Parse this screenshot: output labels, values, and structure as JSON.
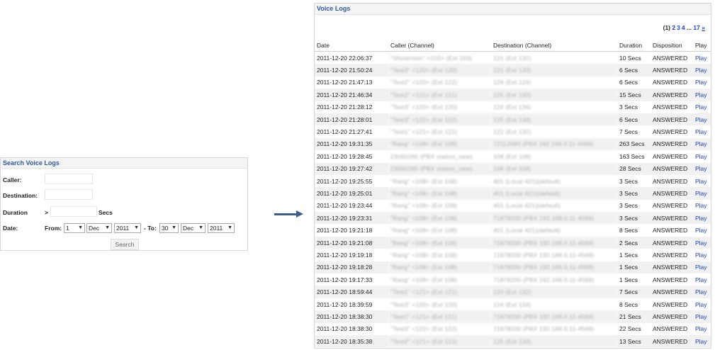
{
  "search": {
    "title": "Search Voice Logs",
    "caller_label": "Caller:",
    "destination_label": "Destination:",
    "duration_label": "Duration",
    "duration_op": ">",
    "duration_unit": "Secs",
    "date_label": "Date:",
    "from_label": "From:",
    "from_day": "1",
    "from_month": "Dec",
    "from_year": "2011",
    "to_label": "- To:",
    "to_day": "30",
    "to_month": "Dec",
    "to_year": "2011",
    "button": "Search"
  },
  "logs": {
    "title": "Voice Logs",
    "pagination": {
      "current": "(1)",
      "pages": [
        "2",
        "3",
        "4"
      ],
      "ellipsis": "...",
      "last": "17",
      "next": "»"
    },
    "columns": {
      "date": "Date",
      "caller": "Caller (Channel)",
      "destination": "Destination (Channel)",
      "duration": "Duration",
      "disposition": "Disposition",
      "play": "Play"
    },
    "rows": [
      {
        "date": "2011-12-20 22:06:37",
        "caller": "\"Showroom\" <103> (Ext 103)",
        "destination": "121 (Ext 132)",
        "duration": "10 Secs",
        "disposition": "ANSWERED",
        "play": "Play"
      },
      {
        "date": "2011-12-20 21:50:24",
        "caller": "\"Test3\" <120> (Ext 120)",
        "destination": "121 (Ext 133)",
        "duration": "6 Secs",
        "disposition": "ANSWERED",
        "play": "Play"
      },
      {
        "date": "2011-12-20 21:47:13",
        "caller": "\"Test2\" <120> (Ext 122)",
        "destination": "126 (Ext 124)",
        "duration": "6 Secs",
        "disposition": "ANSWERED",
        "play": "Play"
      },
      {
        "date": "2011-12-20 21:46:34",
        "caller": "\"Test2\" <121> (Ext 121)",
        "destination": "125 (Ext 133)",
        "duration": "15 Secs",
        "disposition": "ANSWERED",
        "play": "Play"
      },
      {
        "date": "2011-12-20 21:28:12",
        "caller": "\"Test3\" <120> (Ext 120)",
        "destination": "124 (Ext 134)",
        "duration": "3 Secs",
        "disposition": "ANSWERED",
        "play": "Play"
      },
      {
        "date": "2011-12-20 21:28:01",
        "caller": "\"Test3\" <122> (Ext 122)",
        "destination": "125 (Ext 133)",
        "duration": "6 Secs",
        "disposition": "ANSWERED",
        "play": "Play"
      },
      {
        "date": "2011-12-20 21:27:41",
        "caller": "\"Test1\" <121> (Ext 121)",
        "destination": "122 (Ext 132)",
        "duration": "7 Secs",
        "disposition": "ANSWERED",
        "play": "Play"
      },
      {
        "date": "2011-12-20 19:31:35",
        "caller": "\"Rang\" <108> (Ext 108)",
        "destination": "72112680 (PBX 192.168.0.11-4569)",
        "duration": "263 Secs",
        "disposition": "ANSWERED",
        "play": "Play"
      },
      {
        "date": "2011-12-20 19:28:45",
        "caller": "23060265 (PBX station_new)",
        "destination": "108 (Ext 108)",
        "duration": "163 Secs",
        "disposition": "ANSWERED",
        "play": "Play"
      },
      {
        "date": "2011-12-20 19:27:42",
        "caller": "23060265 (PBX station_new)",
        "destination": "108 (Ext 108)",
        "duration": "28 Secs",
        "disposition": "ANSWERED",
        "play": "Play"
      },
      {
        "date": "2011-12-20 19:25:55",
        "caller": "\"Rang\" <108> (Ext 108)",
        "destination": "401 (Local 421)(default)",
        "duration": "3 Secs",
        "disposition": "ANSWERED",
        "play": "Play"
      },
      {
        "date": "2011-12-20 19:25:01",
        "caller": "\"Rang\" <108> (Ext 108)",
        "destination": "401 (Local 421)(default)",
        "duration": "3 Secs",
        "disposition": "ANSWERED",
        "play": "Play"
      },
      {
        "date": "2011-12-20 19:23:44",
        "caller": "\"Rang\" <108> (Ext 108)",
        "destination": "401 (Local 421)(default)",
        "duration": "3 Secs",
        "disposition": "ANSWERED",
        "play": "Play"
      },
      {
        "date": "2011-12-20 19:23:31",
        "caller": "\"Rang\" <108> (Ext 108)",
        "destination": "71878200 (PBX 192.168.0.11-4569)",
        "duration": "3 Secs",
        "disposition": "ANSWERED",
        "play": "Play"
      },
      {
        "date": "2011-12-20 19:21:18",
        "caller": "\"Rang\" <108> (Ext 108)",
        "destination": "401 (Local 421)(default)",
        "duration": "8 Secs",
        "disposition": "ANSWERED",
        "play": "Play"
      },
      {
        "date": "2011-12-20 19:21:08",
        "caller": "\"Rang\" <108> (Ext 108)",
        "destination": "71878200 (PBX 192.168.0.11-4569)",
        "duration": "2 Secs",
        "disposition": "ANSWERED",
        "play": "Play"
      },
      {
        "date": "2011-12-20 19:19:18",
        "caller": "\"Rang\" <108> (Ext 108)",
        "destination": "71878200 (PBX 192.168.0.11-4569)",
        "duration": "1 Secs",
        "disposition": "ANSWERED",
        "play": "Play"
      },
      {
        "date": "2011-12-20 19:18:28",
        "caller": "\"Rang\" <108> (Ext 108)",
        "destination": "71878200 (PBX 192.168.0.11-4569)",
        "duration": "1 Secs",
        "disposition": "ANSWERED",
        "play": "Play"
      },
      {
        "date": "2011-12-20 19:17:33",
        "caller": "\"Rang\" <108> (Ext 108)",
        "destination": "71878200 (PBX 192.168.0.11-4569)",
        "duration": "1 Secs",
        "disposition": "ANSWERED",
        "play": "Play"
      },
      {
        "date": "2011-12-20 18:59:44",
        "caller": "\"Test1\" <121> (Ext 121)",
        "destination": "120 (Ext 132)",
        "duration": "7 Secs",
        "disposition": "ANSWERED",
        "play": "Play"
      },
      {
        "date": "2011-12-20 18:39:59",
        "caller": "\"Test3\" <120> (Ext 120)",
        "destination": "124 (Ext 134)",
        "duration": "8 Secs",
        "disposition": "ANSWERED",
        "play": "Play"
      },
      {
        "date": "2011-12-20 18:38:30",
        "caller": "\"Test1\" <121> (Ext 121)",
        "destination": "71878200 (PBX 192.168.0.11-4569)",
        "duration": "21 Secs",
        "disposition": "ANSWERED",
        "play": "Play"
      },
      {
        "date": "2011-12-20 18:38:30",
        "caller": "\"Test3\" <122> (Ext 122)",
        "destination": "71878200 (PBX 192.168.0.11-4569)",
        "duration": "22 Secs",
        "disposition": "ANSWERED",
        "play": "Play"
      },
      {
        "date": "2011-12-20 18:35:38",
        "caller": "\"Test2\" <121> (Ext 121)",
        "destination": "125 (Ext 133)",
        "duration": "13 Secs",
        "disposition": "ANSWERED",
        "play": "Play"
      }
    ]
  },
  "colors": {
    "title_blue": "#2d5aa0",
    "link_blue": "#1a3fcf",
    "arrow": "#3a5f8f",
    "row_alt": "#f1f1f1"
  }
}
